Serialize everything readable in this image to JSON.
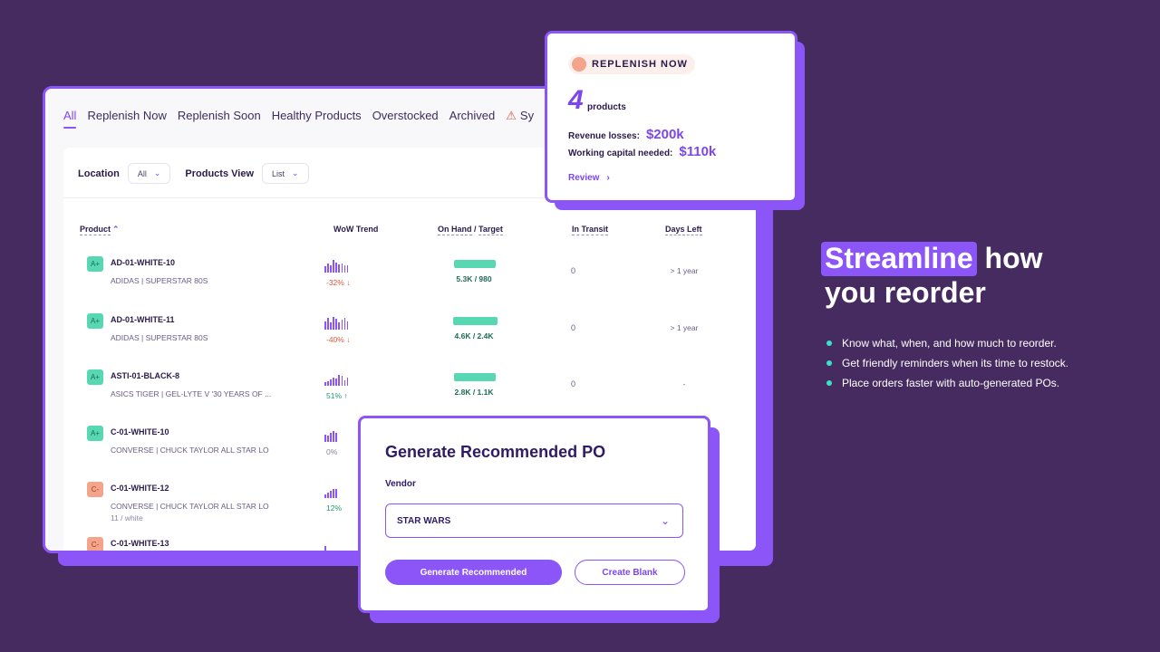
{
  "tabs": [
    {
      "label": "All",
      "active": true
    },
    {
      "label": "Replenish Now"
    },
    {
      "label": "Replenish Soon"
    },
    {
      "label": "Healthy Products"
    },
    {
      "label": "Overstocked"
    },
    {
      "label": "Archived"
    },
    {
      "label": "Sy",
      "icon": "warning-icon"
    }
  ],
  "filters": {
    "location_label": "Location",
    "location_value": "All",
    "view_label": "Products View",
    "view_value": "List"
  },
  "table": {
    "headers": {
      "product": "Product",
      "wow_trend": "WoW Trend",
      "on_hand": "On Hand",
      "slash": " / ",
      "target": "Target",
      "in_transit": "In Transit",
      "days_left": "Days Left"
    },
    "rows": [
      {
        "grade": "A+",
        "grade_type": "a",
        "sku": "AD-01-WHITE-10",
        "name": "ADIDAS | SUPERSTAR 80S",
        "variant": "",
        "trend": "-32% ↓",
        "trend_dir": "down",
        "spark": [
          5,
          8,
          6,
          12,
          9,
          7,
          8,
          6,
          6
        ],
        "on_hand": "5.3K / 980",
        "on_hand_fill": 1.0,
        "in_transit": "0",
        "days_left": "> 1 year"
      },
      {
        "grade": "A+",
        "grade_type": "a",
        "sku": "AD-01-WHITE-11",
        "name": "ADIDAS | SUPERSTAR 80S",
        "variant": "",
        "trend": "-40% ↓",
        "trend_dir": "down",
        "spark": [
          7,
          11,
          6,
          12,
          10,
          6,
          9,
          11,
          7
        ],
        "on_hand": "4.6K / 2.4K",
        "on_hand_fill": 1.0,
        "in_transit": "0",
        "days_left": "> 1 year"
      },
      {
        "grade": "A+",
        "grade_type": "a",
        "sku": "ASTI-01-BLACK-8",
        "name": "ASICS TIGER | GEL-LYTE V '30 YEARS OF ...",
        "variant": "",
        "trend": "51% ↑",
        "trend_dir": "up",
        "spark": [
          2,
          3,
          5,
          7,
          6,
          10,
          9,
          4,
          7
        ],
        "on_hand": "2.8K / 1.1K",
        "on_hand_fill": 1.0,
        "in_transit": "0",
        "days_left": "-"
      },
      {
        "grade": "A+",
        "grade_type": "a",
        "sku": "C-01-WHITE-10",
        "name": "CONVERSE | CHUCK TAYLOR ALL STAR LO",
        "variant": "",
        "trend": "0%",
        "trend_dir": "flat",
        "spark": [
          6,
          5,
          8,
          10,
          8
        ],
        "on_hand": "",
        "in_transit": "",
        "days_left": ""
      },
      {
        "grade": "C-",
        "grade_type": "c",
        "sku": "C-01-WHITE-12",
        "name": "CONVERSE | CHUCK TAYLOR ALL STAR LO",
        "variant": "11 / white",
        "trend": "12%",
        "trend_dir": "up",
        "spark": [
          2,
          4,
          6,
          8,
          8
        ],
        "on_hand": "",
        "in_transit": "",
        "days_left": ""
      },
      {
        "grade": "C-",
        "grade_type": "c",
        "sku": "C-01-WHITE-13",
        "name": "",
        "variant": "",
        "trend": "",
        "trend_dir": "flat",
        "spark": [
          6
        ],
        "on_hand": "",
        "in_transit": "",
        "days_left": ""
      }
    ]
  },
  "replenish_card": {
    "badge": "REPLENISH NOW",
    "count": "4",
    "count_unit": "products",
    "revenue_label": "Revenue losses:",
    "revenue_value": "$200k",
    "capital_label": "Working capital needed:",
    "capital_value": "$110k",
    "review_label": "Review",
    "review_arrow": "›"
  },
  "po_modal": {
    "title": "Generate Recommended PO",
    "vendor_label": "Vendor",
    "vendor_value": "STAR WARS",
    "primary_button": "Generate Recommended",
    "secondary_button": "Create Blank"
  },
  "marketing": {
    "headline_highlight": "Streamline",
    "headline_rest_1": " how",
    "headline_line_2": "you reorder",
    "bullets": [
      "Know what, when, and how much to reorder.",
      "Get friendly reminders when its time to restock.",
      "Place orders faster with auto-generated POs."
    ]
  },
  "colors": {
    "background": "#452b5f",
    "accent": "#8b55f7",
    "teal": "#57d8b3",
    "coral": "#f5a48c",
    "bullet": "#3fe0c9"
  }
}
